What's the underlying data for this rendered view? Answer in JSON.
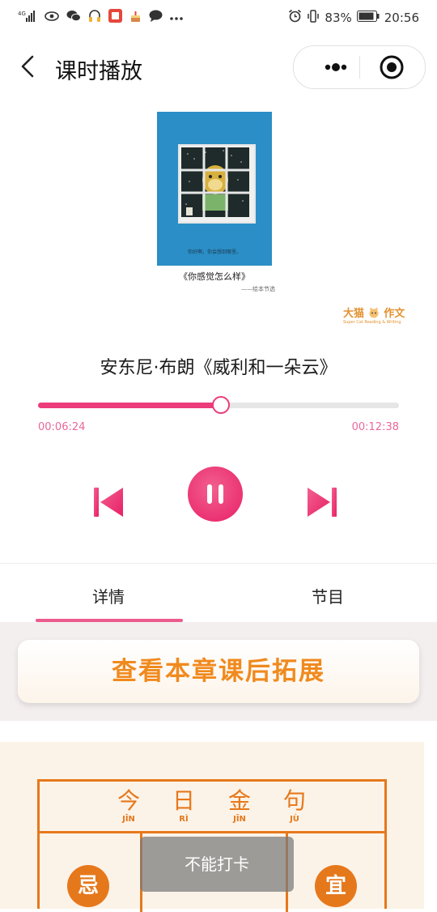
{
  "status_bar": {
    "network": "4G",
    "battery": "83%",
    "time": "20:56",
    "icons_left": [
      "signal-icon",
      "eye-icon",
      "wechat-icon",
      "headset-icon",
      "ting-app-icon",
      "cake-icon",
      "chat-icon",
      "more-icon"
    ],
    "icons_right": [
      "alarm-icon",
      "vibrate-icon",
      "battery-icon"
    ]
  },
  "header": {
    "title": "课时播放",
    "capsule_icons": [
      "more-dots-icon",
      "close-target-icon"
    ]
  },
  "cover": {
    "caption": "你好啊，你会想到哪里。",
    "book_title": "《你感觉怎么样》",
    "book_subtitle": "——绘本节选",
    "logo_main": "大猫",
    "logo_suffix": "作文",
    "logo_tagline": "Super Cat Reading & Writing"
  },
  "player": {
    "track_title": "安东尼·布朗《威利和一朵云》",
    "elapsed": "00:06:24",
    "total": "00:12:38",
    "progress": 0.506,
    "accent_color": "#ec3c7b"
  },
  "tabs": [
    {
      "label": "详情",
      "active": true
    },
    {
      "label": "节目",
      "active": false
    }
  ],
  "extension_button": {
    "label": "查看本章课后拓展"
  },
  "golden_sentence": {
    "header": [
      {
        "char": "今",
        "pinyin": "JĪN"
      },
      {
        "char": "日",
        "pinyin": "RÌ"
      },
      {
        "char": "金",
        "pinyin": "JĪN"
      },
      {
        "char": "句",
        "pinyin": "JÙ"
      }
    ],
    "left_seal": "忌",
    "right_seal": "宜"
  },
  "toast": {
    "message": "不能打卡"
  }
}
